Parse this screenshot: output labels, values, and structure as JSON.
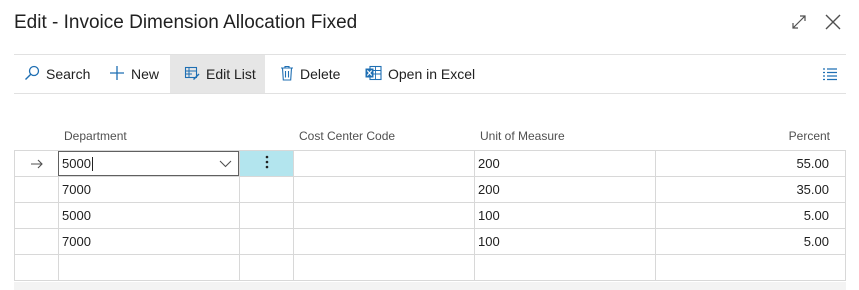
{
  "window": {
    "title": "Edit - Invoice Dimension Allocation Fixed",
    "expand_icon": "expand-diagonal-icon",
    "close_icon": "close-icon"
  },
  "actions": {
    "search": "Search",
    "new": "New",
    "edit_list": "Edit List",
    "delete": "Delete",
    "open_in_excel": "Open in Excel",
    "list_menu_icon": "list-view-icon"
  },
  "columns": {
    "department": "Department",
    "cost_center_code": "Cost Center Code",
    "unit_of_measure": "Unit of Measure",
    "percent": "Percent"
  },
  "rows": [
    {
      "department": "5000",
      "cost_center_code": "",
      "unit_of_measure": "200",
      "percent": "55.00"
    },
    {
      "department": "7000",
      "cost_center_code": "",
      "unit_of_measure": "200",
      "percent": "35.00"
    },
    {
      "department": "5000",
      "cost_center_code": "",
      "unit_of_measure": "100",
      "percent": "5.00"
    },
    {
      "department": "7000",
      "cost_center_code": "",
      "unit_of_measure": "100",
      "percent": "5.00"
    },
    {
      "department": "",
      "cost_center_code": "",
      "unit_of_measure": "",
      "percent": ""
    }
  ],
  "current_row_indicator": "arrow-right-icon",
  "accent_color": "#b3e5ee"
}
